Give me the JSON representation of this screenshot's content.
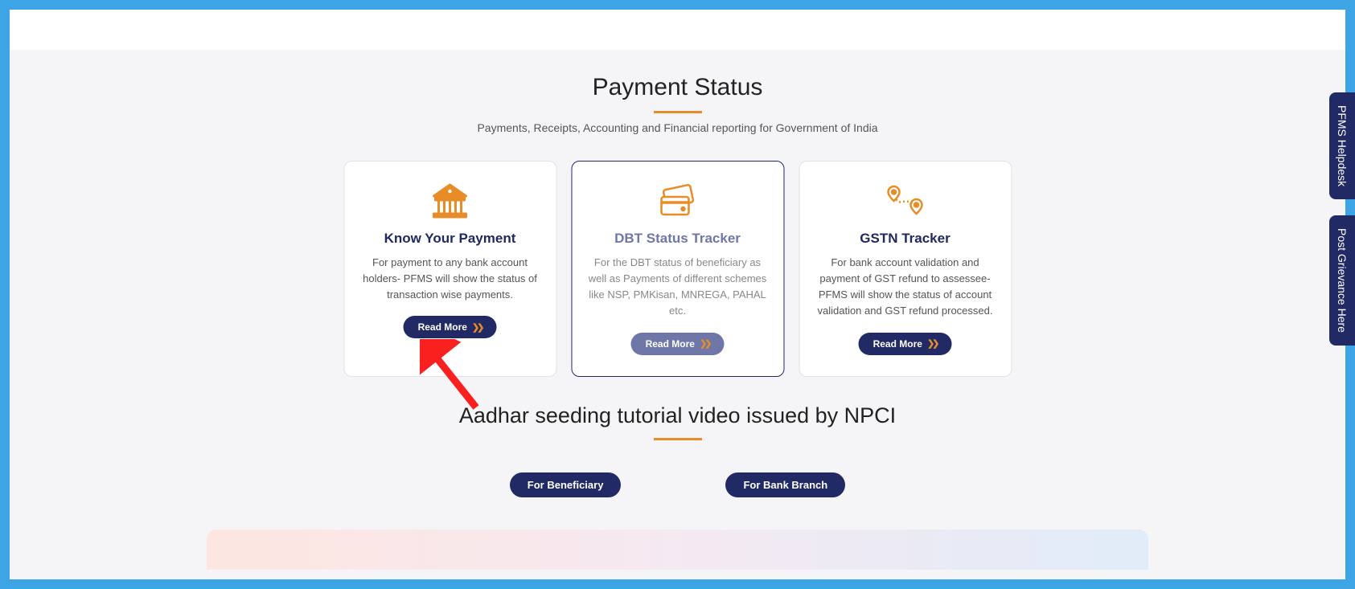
{
  "section1": {
    "title": "Payment Status",
    "subtitle": "Payments, Receipts, Accounting and Financial reporting for Government of India"
  },
  "cards": [
    {
      "title": "Know Your Payment",
      "desc": "For payment to any bank account holders- PFMS will show the status of transaction wise payments.",
      "button": "Read More"
    },
    {
      "title": "DBT Status Tracker",
      "desc": "For the DBT status of beneficiary as well as Payments of different schemes like NSP, PMKisan, MNREGA, PAHAL etc.",
      "button": "Read More"
    },
    {
      "title": "GSTN Tracker",
      "desc": "For bank account validation and payment of GST refund to assessee- PFMS will show the status of account validation and GST refund processed.",
      "button": "Read More"
    }
  ],
  "section2": {
    "title": "Aadhar seeding tutorial video issued by NPCI",
    "buttons": [
      "For Beneficiary",
      "For Bank Branch"
    ]
  },
  "sidetabs": [
    "PFMS Helpdesk",
    "Post Grievance Here"
  ]
}
